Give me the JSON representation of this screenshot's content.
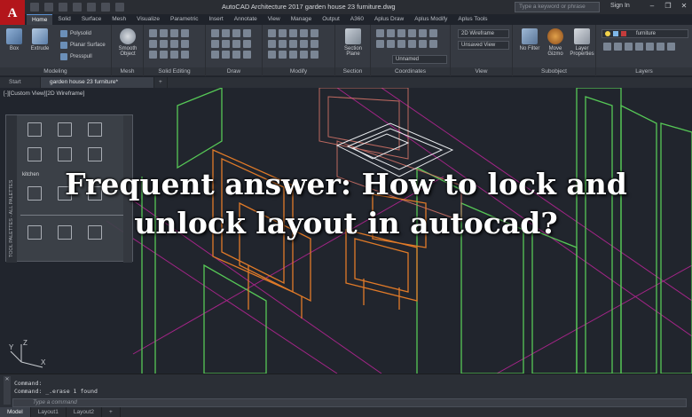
{
  "app": {
    "logo": "A",
    "title": "AutoCAD Architecture 2017   garden house 23 furniture.dwg",
    "search_placeholder": "Type a keyword or phrase",
    "sign_in": "Sign In"
  },
  "ribbon_tabs": [
    "Home",
    "Solid",
    "Surface",
    "Mesh",
    "Visualize",
    "Parametric",
    "Insert",
    "Annotate",
    "View",
    "Manage",
    "Output",
    "A360",
    "Aplus Draw",
    "Aplus Modify",
    "Aplus Tools"
  ],
  "ribbon": {
    "box_label": "Box",
    "extrude_label": "Extrude",
    "polysolid": "Polysolid",
    "planar_surface": "Planar Surface",
    "presspull": "Presspull",
    "smooth_object": "Smooth Object",
    "section_plane": "Section Plane",
    "visual_style": "2D Wireframe",
    "view_state": "Unsaved View",
    "ucs": "Unnamed",
    "no_filter": "No Filter",
    "move_gizmo": "Move Gizmo",
    "layer_properties": "Layer Properties",
    "layer_name": "furniture",
    "groups": {
      "modeling": "Modeling",
      "mesh": "Mesh",
      "solid_editing": "Solid Editing",
      "draw": "Draw",
      "modify": "Modify",
      "section": "Section",
      "coordinates": "Coordinates",
      "view": "View",
      "subobject": "Subobject",
      "layers": "Layers"
    }
  },
  "doc_tabs": [
    "Start",
    "garden house 23 furniture*"
  ],
  "viewport": {
    "label": "[-][Custom View][2D Wireframe]"
  },
  "palette": {
    "kitchen_label": "kitchen",
    "strip_text": "TOOL PALETTES - ALL PALETTES"
  },
  "headline": {
    "line1": "Frequent answer: How to lock and",
    "line2": "unlock layout in autocad?"
  },
  "ucs_icon": {
    "y": "Y",
    "z": "Z",
    "x": "X"
  },
  "command": {
    "line1": "Command:",
    "line2": "Command:  _.erase 1 found",
    "placeholder": "Type a command"
  },
  "layout_tabs": [
    "Model",
    "Layout1",
    "Layout2"
  ],
  "colors": {
    "accent": "#b3161b",
    "wire_green": "#5fd35f",
    "wire_orange": "#e0782a",
    "wire_magenta": "#c02a9a"
  }
}
